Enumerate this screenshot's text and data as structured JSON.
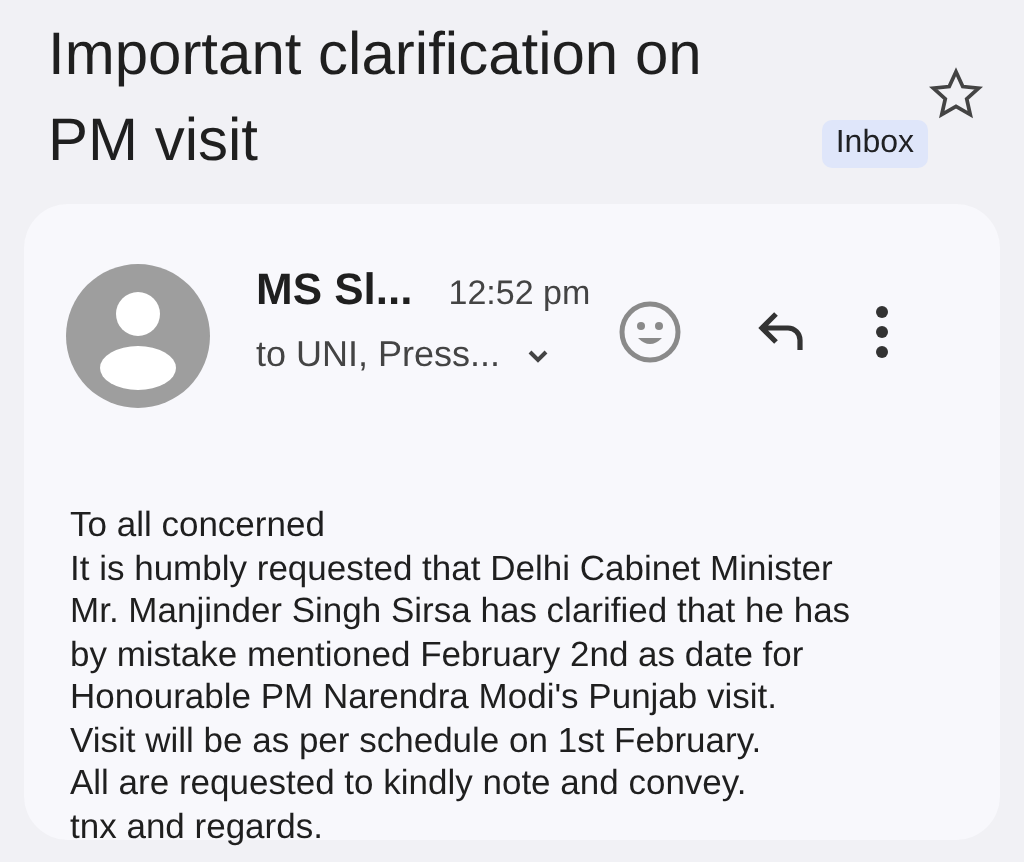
{
  "subject": {
    "title": "Important clarification on PM visit",
    "label": "Inbox",
    "starred": false
  },
  "message": {
    "sender": "MS Sl...",
    "time": "12:52 pm",
    "recipients": "to UNI, Press...",
    "body": [
      "To all concerned",
      "It is humbly requested that Delhi Cabinet Minister",
      "Mr. Manjinder Singh Sirsa has clarified that he has",
      "by mistake mentioned February 2nd as date for",
      "Honourable PM Narendra Modi's Punjab visit.",
      "Visit will be as per schedule on 1st February.",
      "All are requested to kindly note and convey.",
      "tnx and regards."
    ]
  }
}
